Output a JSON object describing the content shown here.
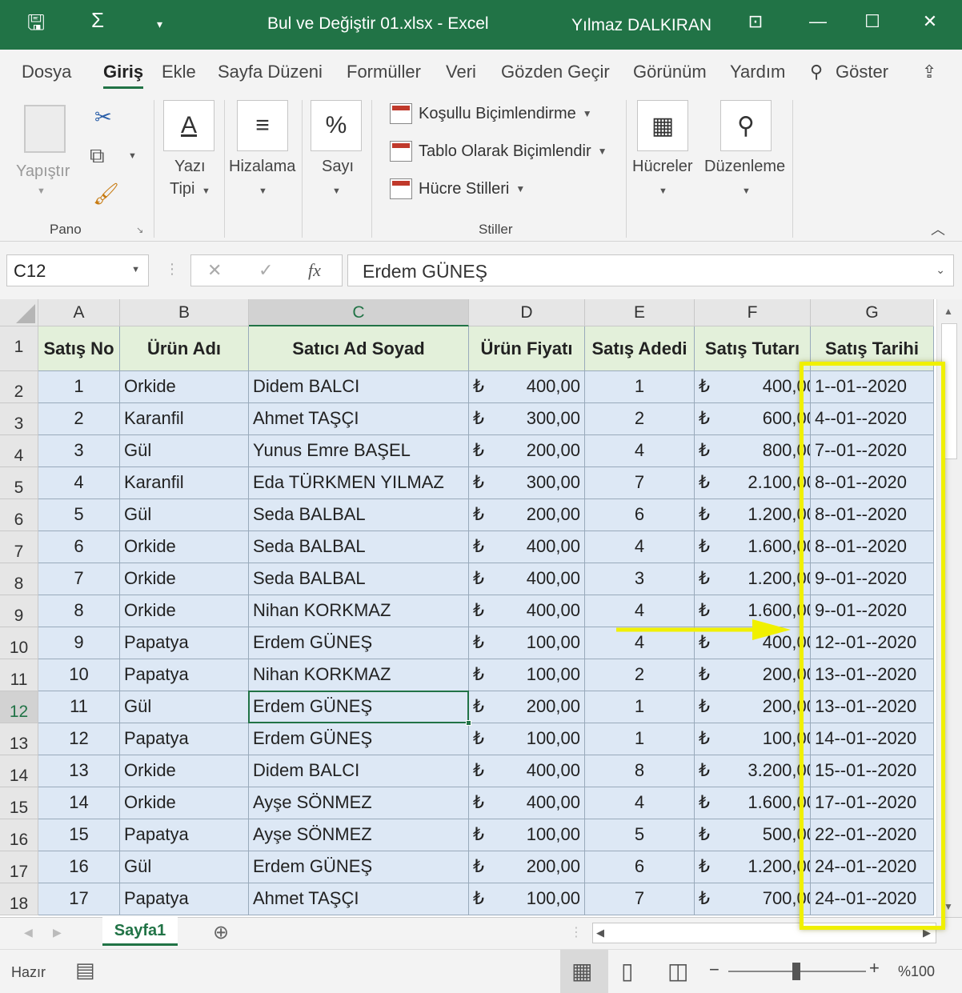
{
  "window": {
    "title": "Bul ve Değiştir 01.xlsx  -  Excel",
    "user": "Yılmaz DALKIRAN"
  },
  "tabs": [
    "Dosya",
    "Giriş",
    "Ekle",
    "Sayfa Düzeni",
    "Formüller",
    "Veri",
    "Gözden Geçir",
    "Görünüm",
    "Yardım",
    "Göster"
  ],
  "ribbon": {
    "paste_label": "Yapıştır",
    "clipboard_group": "Pano",
    "font_label_1": "Yazı",
    "font_label_2": "Tipi",
    "align_label": "Hizalama",
    "number_label": "Sayı",
    "styles": [
      "Koşullu Biçimlendirme",
      "Tablo Olarak Biçimlendir",
      "Hücre Stilleri"
    ],
    "styles_group": "Stiller",
    "cells_label": "Hücreler",
    "edit_label": "Düzenleme"
  },
  "formula_bar": {
    "name_box": "C12",
    "fx": "fx",
    "value": "Erdem GÜNEŞ"
  },
  "columns": [
    "A",
    "B",
    "C",
    "D",
    "E",
    "F",
    "G"
  ],
  "headers": [
    "Satış No",
    "Ürün Adı",
    "Satıcı Ad Soyad",
    "Ürün Fiyatı",
    "Satış Adedi",
    "Satış Tutarı",
    "Satış Tarihi"
  ],
  "currency_symbol": "₺",
  "rows": [
    [
      "1",
      "Orkide",
      "Didem BALCI",
      "400,00",
      "1",
      "400,00",
      "1--01--2020"
    ],
    [
      "2",
      "Karanfil",
      "Ahmet TAŞÇI",
      "300,00",
      "2",
      "600,00",
      "4--01--2020"
    ],
    [
      "3",
      "Gül",
      "Yunus Emre BAŞEL",
      "200,00",
      "4",
      "800,00",
      "7--01--2020"
    ],
    [
      "4",
      "Karanfil",
      "Eda TÜRKMEN YILMAZ",
      "300,00",
      "7",
      "2.100,00",
      "8--01--2020"
    ],
    [
      "5",
      "Gül",
      "Seda BALBAL",
      "200,00",
      "6",
      "1.200,00",
      "8--01--2020"
    ],
    [
      "6",
      "Orkide",
      "Seda BALBAL",
      "400,00",
      "4",
      "1.600,00",
      "8--01--2020"
    ],
    [
      "7",
      "Orkide",
      "Seda BALBAL",
      "400,00",
      "3",
      "1.200,00",
      "9--01--2020"
    ],
    [
      "8",
      "Orkide",
      "Nihan KORKMAZ",
      "400,00",
      "4",
      "1.600,00",
      "9--01--2020"
    ],
    [
      "9",
      "Papatya",
      "Erdem GÜNEŞ",
      "100,00",
      "4",
      "400,00",
      "12--01--2020"
    ],
    [
      "10",
      "Papatya",
      "Nihan KORKMAZ",
      "100,00",
      "2",
      "200,00",
      "13--01--2020"
    ],
    [
      "11",
      "Gül",
      "Erdem GÜNEŞ",
      "200,00",
      "1",
      "200,00",
      "13--01--2020"
    ],
    [
      "12",
      "Papatya",
      "Erdem GÜNEŞ",
      "100,00",
      "1",
      "100,00",
      "14--01--2020"
    ],
    [
      "13",
      "Orkide",
      "Didem BALCI",
      "400,00",
      "8",
      "3.200,00",
      "15--01--2020"
    ],
    [
      "14",
      "Orkide",
      "Ayşe SÖNMEZ",
      "400,00",
      "4",
      "1.600,00",
      "17--01--2020"
    ],
    [
      "15",
      "Papatya",
      "Ayşe SÖNMEZ",
      "100,00",
      "5",
      "500,00",
      "22--01--2020"
    ],
    [
      "16",
      "Gül",
      "Erdem GÜNEŞ",
      "200,00",
      "6",
      "1.200,00",
      "24--01--2020"
    ],
    [
      "17",
      "Papatya",
      "Ahmet TAŞÇI",
      "100,00",
      "7",
      "700,00",
      "24--01--2020"
    ]
  ],
  "selected_row": 12,
  "selected_col": "C",
  "sheet_tab": "Sayfa1",
  "status": {
    "ready": "Hazır",
    "zoom": "%100"
  },
  "colors": {
    "excel_green": "#217346",
    "header_fill": "#e3f0da",
    "data_fill": "#dde8f5",
    "highlight": "#f0f000"
  }
}
